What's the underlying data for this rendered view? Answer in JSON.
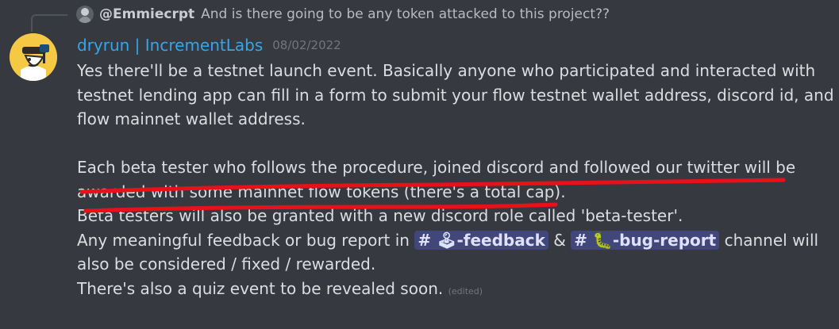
{
  "reply": {
    "username": "@Emmiecrpt",
    "text": "And is there going to be any token attacked to this project??"
  },
  "message": {
    "author": "dryrun | IncrementLabs",
    "timestamp": "08/02/2022",
    "lines": [
      "Yes there'll be a testnet launch event. Basically anyone who participated and interacted with",
      "testnet lending app can fill in a form to submit your flow testnet wallet address, discord id, and",
      "flow mainnet wallet address.",
      "Each beta tester who follows the procedure, joined discord and followed our twitter will be",
      "awarded with some mainnet flow tokens (there's a total cap).",
      "Beta testers will also be granted with a new discord role called 'beta-tester'."
    ],
    "feedback_line": {
      "prefix": "Any meaningful feedback or bug report in",
      "channel_feedback": "# 🕹-feedback",
      "separator": "&",
      "channel_bug_report": "# 🐛-bug-report",
      "suffix": "channel will"
    },
    "line_fixed": "also be considered / fixed / rewarded.",
    "line_quiz": "There's also a quiz event to be revealed soon.",
    "edited_label": "(edited)"
  },
  "annotation": {
    "underline_color": "#e8111a"
  },
  "colors": {
    "background": "#36393f",
    "author": "#36a6e8",
    "text": "#dcddde",
    "mention_bg": "#4a4f8c"
  }
}
